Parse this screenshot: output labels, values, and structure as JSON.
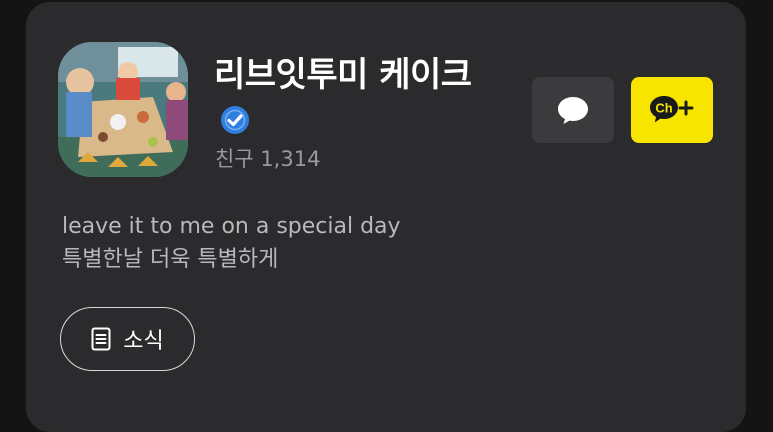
{
  "profile": {
    "name": "리브잇투미 케이크",
    "friends_label": "친구 1,314",
    "description_en": "leave it to me on a special day",
    "description_ko": "특별한날 더욱 특별하게"
  },
  "actions": {
    "chat_icon": "speech-bubble-icon",
    "channel_add_label": "Ch"
  },
  "news": {
    "label": "소식",
    "icon": "document-icon"
  },
  "colors": {
    "card_bg": "#2b2b2d",
    "channel_yellow": "#f7e500",
    "verified_blue": "#2f7fe3"
  }
}
